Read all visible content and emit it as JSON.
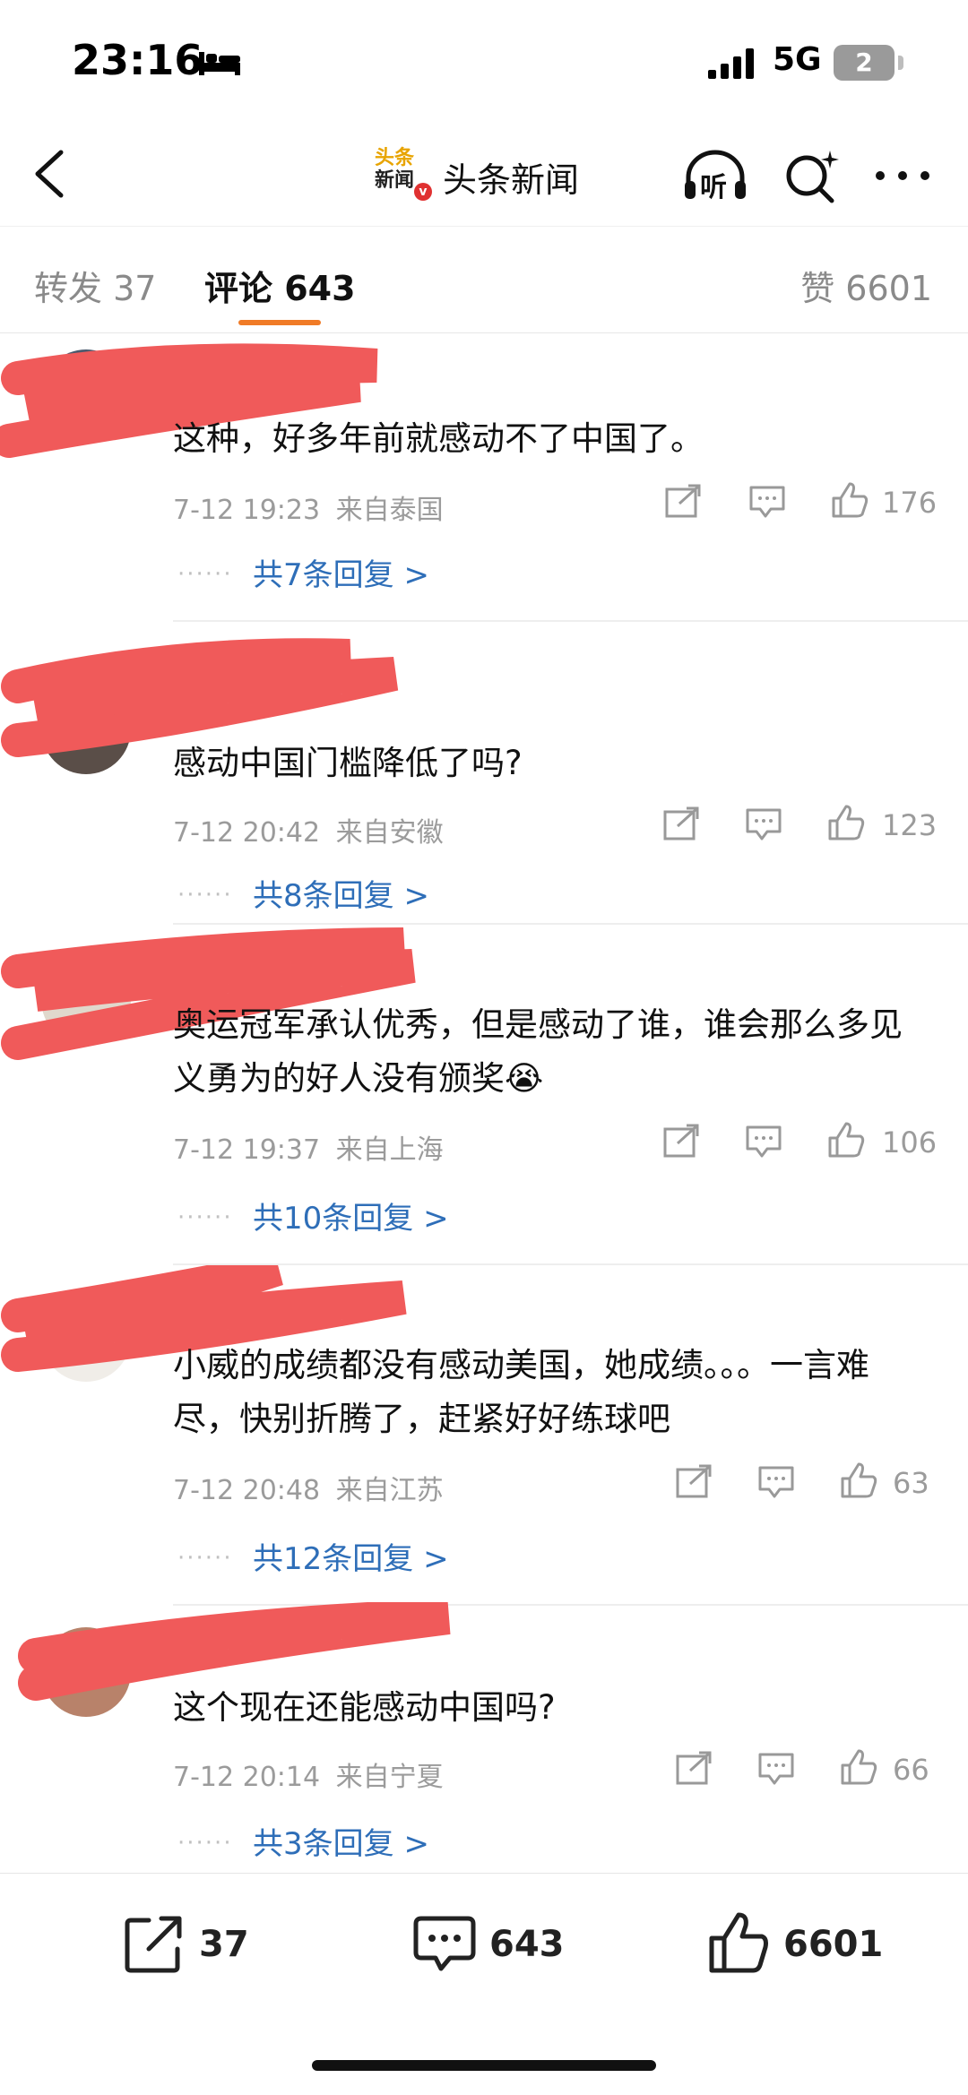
{
  "status_bar": {
    "time": "23:16",
    "network": "5G",
    "battery": "2"
  },
  "nav": {
    "logo_line1": "头条",
    "logo_line2": "新闻",
    "logo_badge": "v",
    "title": "头条新闻",
    "listen_label": "听"
  },
  "tabs": {
    "repost": "转发 37",
    "comments": "评论 643",
    "likes": "赞 6601"
  },
  "comments": [
    {
      "text": "这种，好多年前就感动不了中国了。",
      "time": "7-12 19:23",
      "location": "来自泰国",
      "likes": "176",
      "replies": "共7条回复 >"
    },
    {
      "text": "感动中国门槛降低了吗?",
      "time": "7-12 20:42",
      "location": "来自安徽",
      "likes": "123",
      "replies": "共8条回复 >"
    },
    {
      "text": "奥运冠军承认优秀，但是感动了谁，谁会那么多见义勇为的好人没有颁奖😭",
      "time": "7-12 19:37",
      "location": "来自上海",
      "likes": "106",
      "replies": "共10条回复 >"
    },
    {
      "text": "小威的成绩都没有感动美国，她成绩。。。一言难尽，快别折腾了，赶紧好好练球吧",
      "time": "7-12 20:48",
      "location": "来自江苏",
      "likes": "63",
      "replies": "共12条回复 >"
    },
    {
      "text": "这个现在还能感动中国吗?",
      "time": "7-12 20:14",
      "location": "来自宁夏",
      "likes": "66",
      "replies": "共3条回复 >"
    }
  ],
  "reply_dots": "······",
  "bottom_bar": {
    "repost_count": "37",
    "comment_count": "643",
    "like_count": "6601"
  },
  "colors": {
    "accent_underline": "#f07b27",
    "reply_link": "#2e6eb8",
    "redaction": "#f05a5a"
  }
}
